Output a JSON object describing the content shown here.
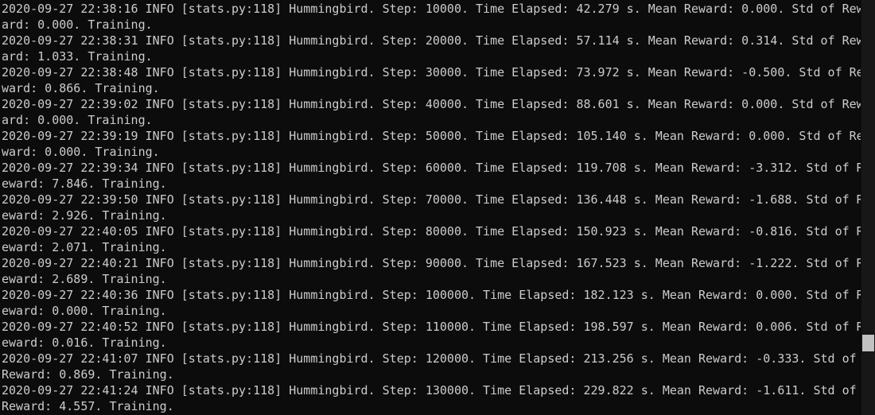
{
  "terminal": {
    "lines": [
      "2020-09-27 22:38:16 INFO [stats.py:118] Hummingbird. Step: 10000. Time Elapsed: 42.279 s. Mean Reward: 0.000. Std of Rew",
      "ard: 0.000. Training.",
      "2020-09-27 22:38:31 INFO [stats.py:118] Hummingbird. Step: 20000. Time Elapsed: 57.114 s. Mean Reward: 0.314. Std of Rew",
      "ard: 1.033. Training.",
      "2020-09-27 22:38:48 INFO [stats.py:118] Hummingbird. Step: 30000. Time Elapsed: 73.972 s. Mean Reward: -0.500. Std of Re",
      "ward: 0.866. Training.",
      "2020-09-27 22:39:02 INFO [stats.py:118] Hummingbird. Step: 40000. Time Elapsed: 88.601 s. Mean Reward: 0.000. Std of Rew",
      "ard: 0.000. Training.",
      "2020-09-27 22:39:19 INFO [stats.py:118] Hummingbird. Step: 50000. Time Elapsed: 105.140 s. Mean Reward: 0.000. Std of Re",
      "ward: 0.000. Training.",
      "2020-09-27 22:39:34 INFO [stats.py:118] Hummingbird. Step: 60000. Time Elapsed: 119.708 s. Mean Reward: -3.312. Std of R",
      "eward: 7.846. Training.",
      "2020-09-27 22:39:50 INFO [stats.py:118] Hummingbird. Step: 70000. Time Elapsed: 136.448 s. Mean Reward: -1.688. Std of R",
      "eward: 2.926. Training.",
      "2020-09-27 22:40:05 INFO [stats.py:118] Hummingbird. Step: 80000. Time Elapsed: 150.923 s. Mean Reward: -0.816. Std of R",
      "eward: 2.071. Training.",
      "2020-09-27 22:40:21 INFO [stats.py:118] Hummingbird. Step: 90000. Time Elapsed: 167.523 s. Mean Reward: -1.222. Std of R",
      "eward: 2.689. Training.",
      "2020-09-27 22:40:36 INFO [stats.py:118] Hummingbird. Step: 100000. Time Elapsed: 182.123 s. Mean Reward: 0.000. Std of R",
      "eward: 0.000. Training.",
      "2020-09-27 22:40:52 INFO [stats.py:118] Hummingbird. Step: 110000. Time Elapsed: 198.597 s. Mean Reward: 0.006. Std of R",
      "eward: 0.016. Training.",
      "2020-09-27 22:41:07 INFO [stats.py:118] Hummingbird. Step: 120000. Time Elapsed: 213.256 s. Mean Reward: -0.333. Std of",
      "Reward: 0.869. Training.",
      "2020-09-27 22:41:24 INFO [stats.py:118] Hummingbird. Step: 130000. Time Elapsed: 229.822 s. Mean Reward: -1.611. Std of",
      "Reward: 4.557. Training."
    ]
  },
  "colors": {
    "background": "#0c0c0c",
    "text": "#cccccc",
    "scrollbar_track": "#171717",
    "scrollbar_thumb": "#c2c2c2"
  },
  "scrollbar": {
    "position_fraction": 0.99,
    "visible_fraction": 0.04
  }
}
